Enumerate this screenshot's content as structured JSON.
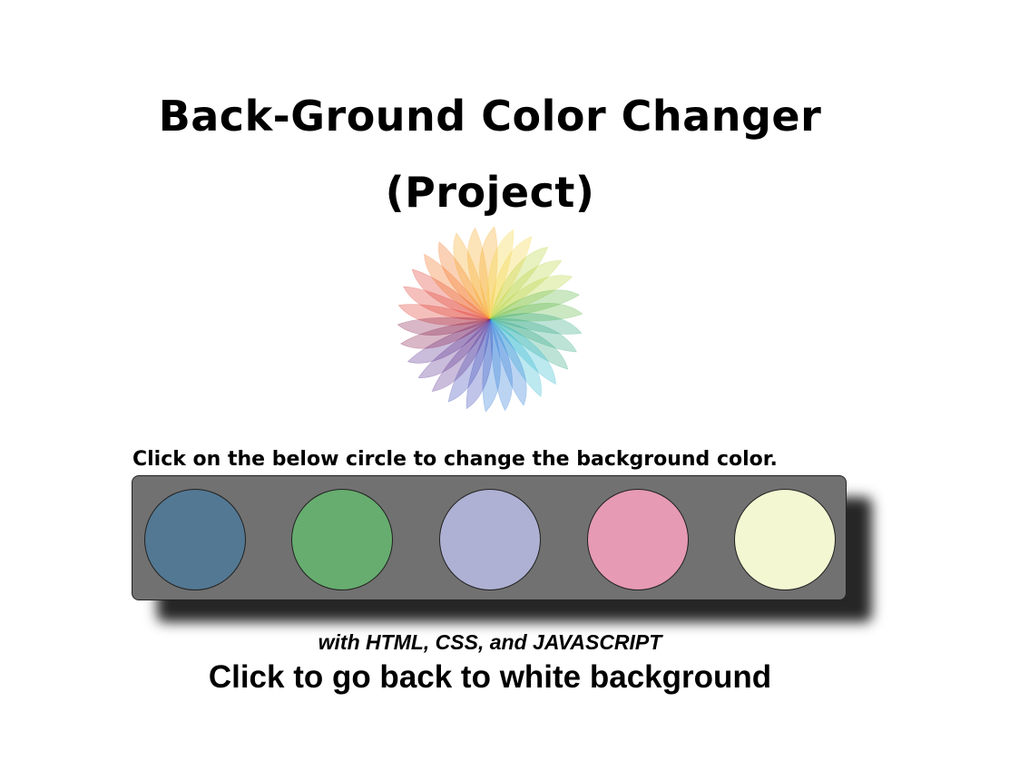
{
  "header": {
    "title_line1": "Back-Ground Color Changer",
    "title_line2": "(Project)"
  },
  "wheel": {
    "icon": "color-wheel-icon",
    "petal_colors": [
      "#e03a2e",
      "#f2711c",
      "#f7a823",
      "#f4d23a",
      "#b8d43c",
      "#5cb843",
      "#33a884",
      "#2fb6cf",
      "#2d79d6",
      "#3a48b8",
      "#5a2f8f",
      "#8a1f4e"
    ]
  },
  "instruction": "Click on the below circle to change the background color.",
  "palette": {
    "background": "#717171",
    "swatches": [
      {
        "color": "#537893"
      },
      {
        "color": "#67ad6f"
      },
      {
        "color": "#aeb1d3"
      },
      {
        "color": "#e69ab4"
      },
      {
        "color": "#f3f7d2"
      }
    ]
  },
  "footer": {
    "subtitle": "with HTML, CSS, and JAVASCRIPT",
    "back_link": "Click to go back to white background"
  }
}
